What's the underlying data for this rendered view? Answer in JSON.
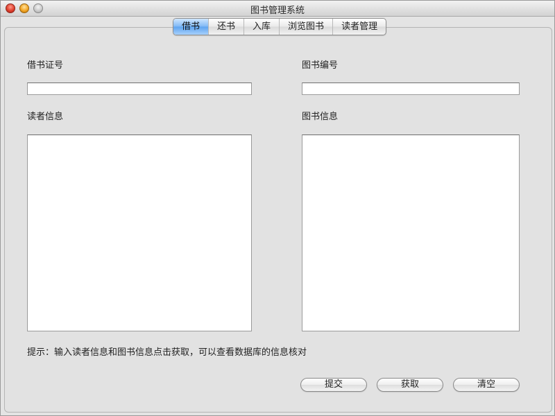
{
  "window": {
    "title": "图书管理系统"
  },
  "tabs": [
    {
      "label": "借书",
      "active": true
    },
    {
      "label": "还书",
      "active": false
    },
    {
      "label": "入库",
      "active": false
    },
    {
      "label": "浏览图书",
      "active": false
    },
    {
      "label": "读者管理",
      "active": false
    }
  ],
  "form": {
    "card_number_label": "借书证号",
    "card_number_value": "",
    "book_number_label": "图书编号",
    "book_number_value": "",
    "reader_info_label": "读者信息",
    "reader_info_value": "",
    "book_info_label": "图书信息",
    "book_info_value": ""
  },
  "hint": "提示：输入读者信息和图书信息点击获取，可以查看数据库的信息核对",
  "buttons": {
    "submit": "提交",
    "fetch": "获取",
    "clear": "清空"
  },
  "colors": {
    "active_tab": "#5ea4f0",
    "window_bg": "#e4e4e4"
  }
}
